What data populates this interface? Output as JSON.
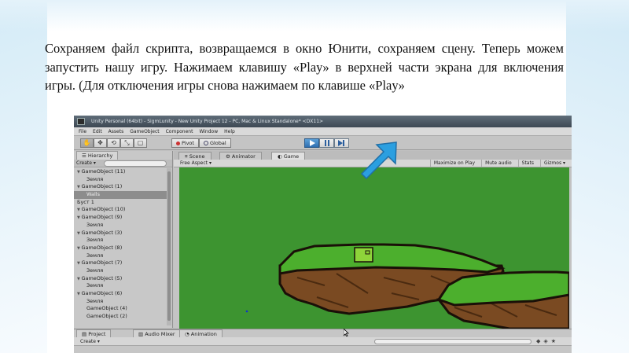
{
  "slide": {
    "paragraph": "Сохраняем файл скрипта, возвращаемся в окно Юнити, сохраняем сцену. Теперь можем запустить нашу игру. Нажимаем клавишу «Play» в верхней части экрана для включения игры. (Для отключения игры снова нажимаем по клавише «Play»"
  },
  "unity": {
    "title": "Unity Personal (64bit) - SigmLunity - New Unity Project 12 - PC, Mac & Linux Standalone* <DX11>",
    "menu": [
      "File",
      "Edit",
      "Assets",
      "GameObject",
      "Component",
      "Window",
      "Help"
    ],
    "toolbar": {
      "tools": [
        "✋",
        "✥",
        "⟲",
        "⤡",
        "▢"
      ],
      "pivot_label": "Pivot",
      "global_label": "Global",
      "play_icon": "play-icon",
      "pause_icon": "pause-icon",
      "step_icon": "step-icon",
      "play_active": true
    },
    "hierarchy": {
      "tab_label": "Hierarchy",
      "create_label": "Create",
      "items": [
        {
          "label": "GameObject (11)",
          "indent": 0,
          "expanded": true
        },
        {
          "label": "Земля",
          "indent": 2
        },
        {
          "label": "GameObject (1)",
          "indent": 0,
          "expanded": true
        },
        {
          "label": "Walls",
          "indent": 2,
          "selected": true
        },
        {
          "label": "Буст 1",
          "indent": 0
        },
        {
          "label": "GameObject (10)",
          "indent": 0,
          "expanded": true
        },
        {
          "label": "GameObject (9)",
          "indent": 0,
          "expanded": true
        },
        {
          "label": "Земля",
          "indent": 2
        },
        {
          "label": "GameObject (3)",
          "indent": 0,
          "expanded": true
        },
        {
          "label": "Земля",
          "indent": 2
        },
        {
          "label": "GameObject (8)",
          "indent": 0,
          "expanded": true
        },
        {
          "label": "Земля",
          "indent": 2
        },
        {
          "label": "GameObject (7)",
          "indent": 0,
          "expanded": true
        },
        {
          "label": "Земля",
          "indent": 2
        },
        {
          "label": "GameObject (5)",
          "indent": 0,
          "expanded": true
        },
        {
          "label": "Земля",
          "indent": 2
        },
        {
          "label": "GameObject (6)",
          "indent": 0,
          "expanded": true
        },
        {
          "label": "Земля",
          "indent": 2
        },
        {
          "label": "GameObject (4)",
          "indent": 2
        },
        {
          "label": "GameObject (2)",
          "indent": 2
        }
      ]
    },
    "view_tabs": [
      "Scene",
      "Animator",
      "Game"
    ],
    "game_bar": {
      "aspect": "Free Aspect",
      "options": [
        "Maximize on Play",
        "Mute audio",
        "Stats",
        "Gizmos ▾"
      ]
    },
    "bottom_tabs": [
      "Project",
      "Audio Mixer",
      "Animation"
    ],
    "bottom_create": "Create",
    "colors": {
      "sky": "#3d9430",
      "grass": "#4caf2d",
      "dirt": "#7a4a22",
      "dirt_dark": "#4a2a10",
      "player": "#8ed43a",
      "arrow": "#2b9fe0"
    }
  }
}
